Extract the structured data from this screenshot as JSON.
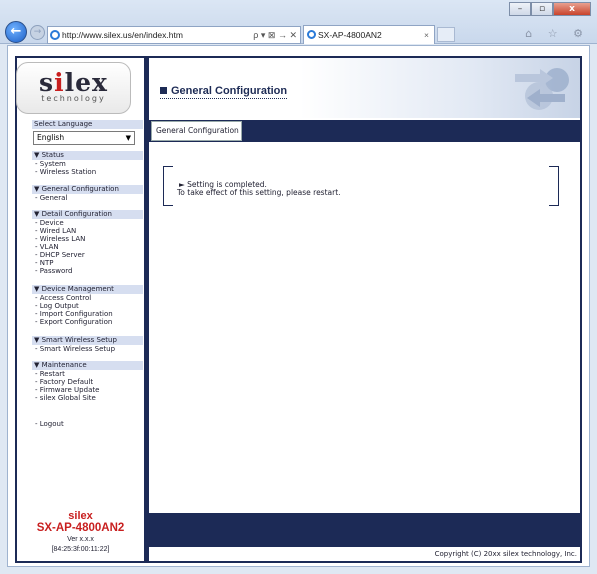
{
  "browser": {
    "address": "http://www.silex.us/en/index.htm",
    "address_tools": "ρ ▾ ⊠ → ✕",
    "tab_title": "SX-AP-4800AN2",
    "tab_close": "×",
    "window_controls": {
      "minimize": "–",
      "maximize": "▫",
      "close": "x"
    },
    "back": "←",
    "forward": "→",
    "toolbar_icons": "⌂ ☆ ⚙"
  },
  "logo": {
    "text_s": "s",
    "text_i": "i",
    "text_rest": "lex",
    "tagline": "technology"
  },
  "language": {
    "label": "Select Language",
    "selected": "English"
  },
  "menu": [
    {
      "header": "▼ Status",
      "items": [
        "- System",
        "- Wireless Station"
      ]
    },
    {
      "header": "▼ General Configuration",
      "items": [
        "- General"
      ]
    },
    {
      "header": "▼ Detail Configuration",
      "items": [
        "- Device",
        "- Wired LAN",
        "- Wireless LAN",
        "- VLAN",
        "- DHCP Server",
        "- NTP",
        "- Password"
      ]
    },
    {
      "header": "▼ Device Management",
      "items": [
        "- Access Control",
        "- Log Output",
        "- Import Configuration",
        "- Export Configuration"
      ]
    },
    {
      "header": "▼ Smart Wireless Setup",
      "items": [
        "- Smart Wireless Setup"
      ]
    },
    {
      "header": "▼ Maintenance",
      "items": [
        "- Restart",
        "- Factory Default",
        "- Firmware Update",
        "- silex Global Site"
      ]
    }
  ],
  "logout": "- Logout",
  "brand": {
    "company": "silex",
    "model": "SX-AP-4800AN2",
    "version": "Ver x.x.x",
    "mac": "[84:25:3f:00:11:22]"
  },
  "page": {
    "title": "General Configuration",
    "tab": "General Configuration",
    "message_line1": "► Setting is completed.",
    "message_line2": "To take effect of this setting, please restart.",
    "copyright": "Copyright (C) 20xx silex technology, Inc."
  }
}
